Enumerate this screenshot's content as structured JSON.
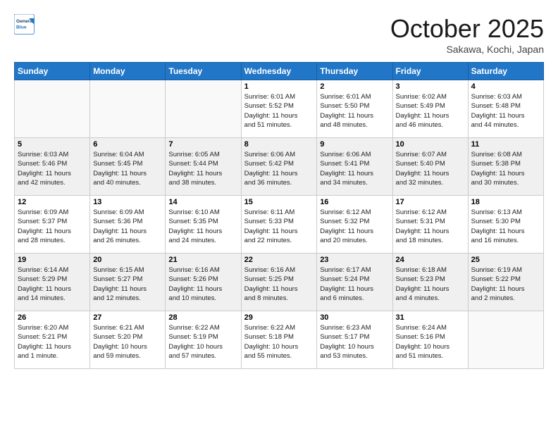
{
  "header": {
    "logo_line1": "General",
    "logo_line2": "Blue",
    "month": "October 2025",
    "location": "Sakawa, Kochi, Japan"
  },
  "weekdays": [
    "Sunday",
    "Monday",
    "Tuesday",
    "Wednesday",
    "Thursday",
    "Friday",
    "Saturday"
  ],
  "weeks": [
    [
      {
        "day": "",
        "info": ""
      },
      {
        "day": "",
        "info": ""
      },
      {
        "day": "",
        "info": ""
      },
      {
        "day": "1",
        "info": "Sunrise: 6:01 AM\nSunset: 5:52 PM\nDaylight: 11 hours\nand 51 minutes."
      },
      {
        "day": "2",
        "info": "Sunrise: 6:01 AM\nSunset: 5:50 PM\nDaylight: 11 hours\nand 48 minutes."
      },
      {
        "day": "3",
        "info": "Sunrise: 6:02 AM\nSunset: 5:49 PM\nDaylight: 11 hours\nand 46 minutes."
      },
      {
        "day": "4",
        "info": "Sunrise: 6:03 AM\nSunset: 5:48 PM\nDaylight: 11 hours\nand 44 minutes."
      }
    ],
    [
      {
        "day": "5",
        "info": "Sunrise: 6:03 AM\nSunset: 5:46 PM\nDaylight: 11 hours\nand 42 minutes."
      },
      {
        "day": "6",
        "info": "Sunrise: 6:04 AM\nSunset: 5:45 PM\nDaylight: 11 hours\nand 40 minutes."
      },
      {
        "day": "7",
        "info": "Sunrise: 6:05 AM\nSunset: 5:44 PM\nDaylight: 11 hours\nand 38 minutes."
      },
      {
        "day": "8",
        "info": "Sunrise: 6:06 AM\nSunset: 5:42 PM\nDaylight: 11 hours\nand 36 minutes."
      },
      {
        "day": "9",
        "info": "Sunrise: 6:06 AM\nSunset: 5:41 PM\nDaylight: 11 hours\nand 34 minutes."
      },
      {
        "day": "10",
        "info": "Sunrise: 6:07 AM\nSunset: 5:40 PM\nDaylight: 11 hours\nand 32 minutes."
      },
      {
        "day": "11",
        "info": "Sunrise: 6:08 AM\nSunset: 5:38 PM\nDaylight: 11 hours\nand 30 minutes."
      }
    ],
    [
      {
        "day": "12",
        "info": "Sunrise: 6:09 AM\nSunset: 5:37 PM\nDaylight: 11 hours\nand 28 minutes."
      },
      {
        "day": "13",
        "info": "Sunrise: 6:09 AM\nSunset: 5:36 PM\nDaylight: 11 hours\nand 26 minutes."
      },
      {
        "day": "14",
        "info": "Sunrise: 6:10 AM\nSunset: 5:35 PM\nDaylight: 11 hours\nand 24 minutes."
      },
      {
        "day": "15",
        "info": "Sunrise: 6:11 AM\nSunset: 5:33 PM\nDaylight: 11 hours\nand 22 minutes."
      },
      {
        "day": "16",
        "info": "Sunrise: 6:12 AM\nSunset: 5:32 PM\nDaylight: 11 hours\nand 20 minutes."
      },
      {
        "day": "17",
        "info": "Sunrise: 6:12 AM\nSunset: 5:31 PM\nDaylight: 11 hours\nand 18 minutes."
      },
      {
        "day": "18",
        "info": "Sunrise: 6:13 AM\nSunset: 5:30 PM\nDaylight: 11 hours\nand 16 minutes."
      }
    ],
    [
      {
        "day": "19",
        "info": "Sunrise: 6:14 AM\nSunset: 5:29 PM\nDaylight: 11 hours\nand 14 minutes."
      },
      {
        "day": "20",
        "info": "Sunrise: 6:15 AM\nSunset: 5:27 PM\nDaylight: 11 hours\nand 12 minutes."
      },
      {
        "day": "21",
        "info": "Sunrise: 6:16 AM\nSunset: 5:26 PM\nDaylight: 11 hours\nand 10 minutes."
      },
      {
        "day": "22",
        "info": "Sunrise: 6:16 AM\nSunset: 5:25 PM\nDaylight: 11 hours\nand 8 minutes."
      },
      {
        "day": "23",
        "info": "Sunrise: 6:17 AM\nSunset: 5:24 PM\nDaylight: 11 hours\nand 6 minutes."
      },
      {
        "day": "24",
        "info": "Sunrise: 6:18 AM\nSunset: 5:23 PM\nDaylight: 11 hours\nand 4 minutes."
      },
      {
        "day": "25",
        "info": "Sunrise: 6:19 AM\nSunset: 5:22 PM\nDaylight: 11 hours\nand 2 minutes."
      }
    ],
    [
      {
        "day": "26",
        "info": "Sunrise: 6:20 AM\nSunset: 5:21 PM\nDaylight: 11 hours\nand 1 minute."
      },
      {
        "day": "27",
        "info": "Sunrise: 6:21 AM\nSunset: 5:20 PM\nDaylight: 10 hours\nand 59 minutes."
      },
      {
        "day": "28",
        "info": "Sunrise: 6:22 AM\nSunset: 5:19 PM\nDaylight: 10 hours\nand 57 minutes."
      },
      {
        "day": "29",
        "info": "Sunrise: 6:22 AM\nSunset: 5:18 PM\nDaylight: 10 hours\nand 55 minutes."
      },
      {
        "day": "30",
        "info": "Sunrise: 6:23 AM\nSunset: 5:17 PM\nDaylight: 10 hours\nand 53 minutes."
      },
      {
        "day": "31",
        "info": "Sunrise: 6:24 AM\nSunset: 5:16 PM\nDaylight: 10 hours\nand 51 minutes."
      },
      {
        "day": "",
        "info": ""
      }
    ]
  ]
}
